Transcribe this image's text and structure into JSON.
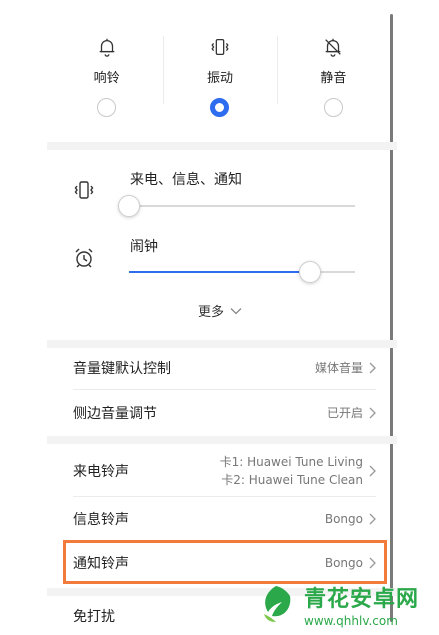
{
  "modes": [
    {
      "label": "响铃",
      "icon": "bell-icon",
      "selected": false
    },
    {
      "label": "振动",
      "icon": "vibrate-icon",
      "selected": true
    },
    {
      "label": "静音",
      "icon": "bell-off-icon",
      "selected": false
    }
  ],
  "volume": {
    "ringtone": {
      "label": "来电、信息、通知",
      "icon": "vibrate-icon",
      "level": 0.0
    },
    "alarm": {
      "label": "闹钟",
      "icon": "alarm-clock-icon",
      "level": 0.8
    }
  },
  "more_label": "更多",
  "settings": [
    {
      "label": "音量键默认控制",
      "value": "媒体音量"
    },
    {
      "label": "侧边音量调节",
      "value": "已开启"
    },
    {
      "label": "来电铃声",
      "value_line1": "卡1: Huawei Tune Living",
      "value_line2": "卡2: Huawei Tune Clean"
    },
    {
      "label": "信息铃声",
      "value": "Bongo"
    },
    {
      "label": "通知铃声",
      "value": "Bongo"
    },
    {
      "label": "免打扰"
    }
  ],
  "watermark": {
    "name": "青花安卓网",
    "url": "www.qhhlv.com"
  },
  "colors": {
    "accent": "#2e6cf0",
    "highlight": "#f27a3a",
    "watermark": "#2aa84a"
  }
}
